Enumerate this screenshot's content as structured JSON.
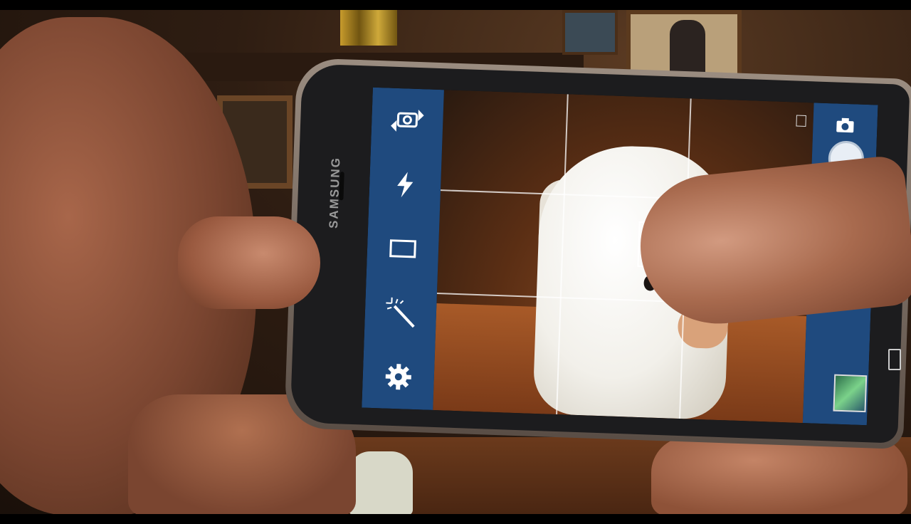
{
  "phone": {
    "brand": "SAMSUNG"
  },
  "camera_app": {
    "left_panel_buttons": [
      {
        "icon": "switch-camera-icon"
      },
      {
        "icon": "flash-icon"
      },
      {
        "icon": "aspect-ratio-icon"
      },
      {
        "icon": "effects-wand-icon"
      },
      {
        "icon": "gear-icon"
      }
    ],
    "right_panel": {
      "mode_icon": "camera-mode-icon",
      "shutter": "shutter-button",
      "gallery": "gallery-thumbnail"
    },
    "viewfinder": {
      "grid": "rule-of-thirds",
      "focus_box": true
    }
  },
  "colors": {
    "panel_blue": "#1f4a7e",
    "grid_white": "#ffffff"
  }
}
